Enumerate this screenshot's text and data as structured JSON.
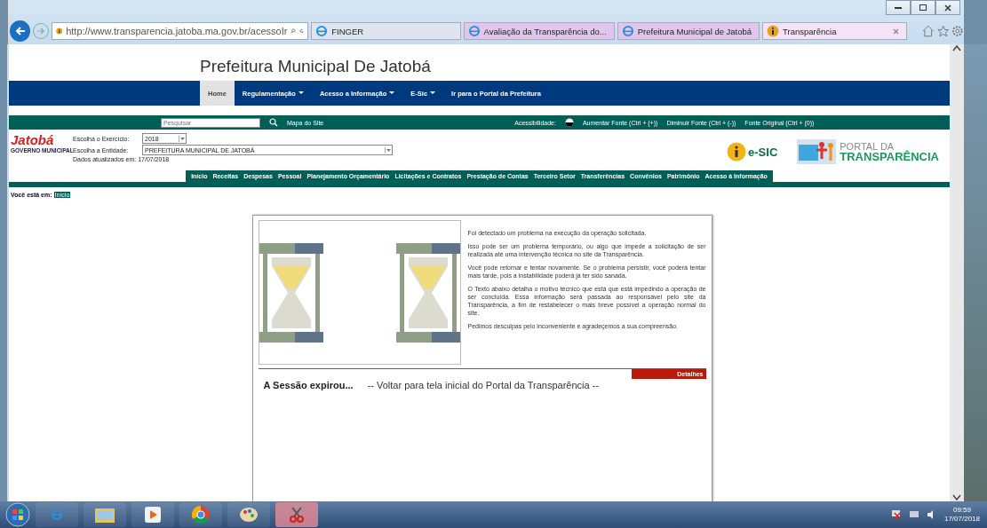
{
  "browser": {
    "address": "http://www.transparencia.jatoba.ma.gov.br/acessoIr",
    "tabs": [
      {
        "title": "FINGER",
        "kind": "ie",
        "selected": false
      },
      {
        "title": "Avaliação da Transparência do...",
        "kind": "ie",
        "selected": false
      },
      {
        "title": "Prefeitura Municipal de Jatobá",
        "kind": "ie",
        "selected": false
      },
      {
        "title": "Transparência",
        "kind": "info",
        "selected": true
      }
    ]
  },
  "page": {
    "title": "Prefeitura Municipal De Jatobá",
    "nav": [
      {
        "label": "Home",
        "selected": true,
        "dropdown": false
      },
      {
        "label": "Regulamentação",
        "selected": false,
        "dropdown": true
      },
      {
        "label": "Acesso a Informação",
        "selected": false,
        "dropdown": true
      },
      {
        "label": "E-Sic",
        "selected": false,
        "dropdown": true
      },
      {
        "label": "Ir para o Portal da Prefeitura",
        "selected": false,
        "dropdown": false
      }
    ],
    "search": {
      "placeholder": "Pesquisar"
    },
    "site_map": "Mapa do Site",
    "accessibility": {
      "label": "Acessibilidade:",
      "links": [
        "Aumentar Fonte (Ctrl + (+))",
        "Diminuir Fonte (Ctrl + (-))",
        "Fonte Original (Ctrl + (0))"
      ]
    },
    "logo": {
      "name": "Jatobá",
      "subtitle": "GOVERNO MUNICIPAL"
    },
    "filters": [
      {
        "label": "Escolha o Exercício:",
        "value": "2018",
        "kind": "short"
      },
      {
        "label": "Escolha a Entidade:",
        "value": "PREFEITURA MUNICIPAL DE JATOBÁ",
        "kind": "long"
      }
    ],
    "updated": "Dados atualizados em: 17/07/2018",
    "esic": "e-SIC",
    "portal": {
      "line1": "PORTAL DA",
      "line2": "TRANSPARÊNCIA"
    },
    "menu": [
      "Início",
      "Receitas",
      "Despesas",
      "Pessoal",
      "Planejamento Orçamentário",
      "Licitações e Contratos",
      "Prestação de Contas",
      "Terceiro Setor",
      "Transferências",
      "Convênios",
      "Patrimônio",
      "Acesso à Informação"
    ],
    "breadcrumb": {
      "label": "Você está em:",
      "items": [
        "Início"
      ]
    },
    "error": {
      "paragraphs": [
        "Foi detectado um problema na execução da operação solicitada.",
        "Isso pode ser um problema temporário, ou algo que impede a solicitação de ser realizada até uma intervenção técnica no site da Transparência.",
        "Você pode retornar e tentar novamente. Se o problema persistir, você poderá tentar mais tarde, pois a instabilidade poderá já ter sido sanada.",
        "O Texto abaixo detalha o motivo técnico que está que está impedindo a operação de ser concluída. Essa informação será passada ao responsável pelo site da Transparência, a fim de restabelecer o mais breve possível a operação normal do site.",
        "Pedimos desculpas pelo inconveniente e agradeçemos a sua compreensão."
      ],
      "details": "Detalhes",
      "heading": "A Sessão expirou...",
      "back_link": "-- Voltar para tela inicial do Portal da Transparência --"
    }
  },
  "taskbar": {
    "apps": [
      {
        "kind": "ie",
        "selected": false
      },
      {
        "kind": "explorer",
        "selected": false
      },
      {
        "kind": "media",
        "selected": false
      },
      {
        "kind": "chrome",
        "selected": false
      },
      {
        "kind": "paint",
        "selected": false
      },
      {
        "kind": "tool",
        "selected": true
      }
    ],
    "time": "09:59",
    "date": "17/07/2018"
  }
}
